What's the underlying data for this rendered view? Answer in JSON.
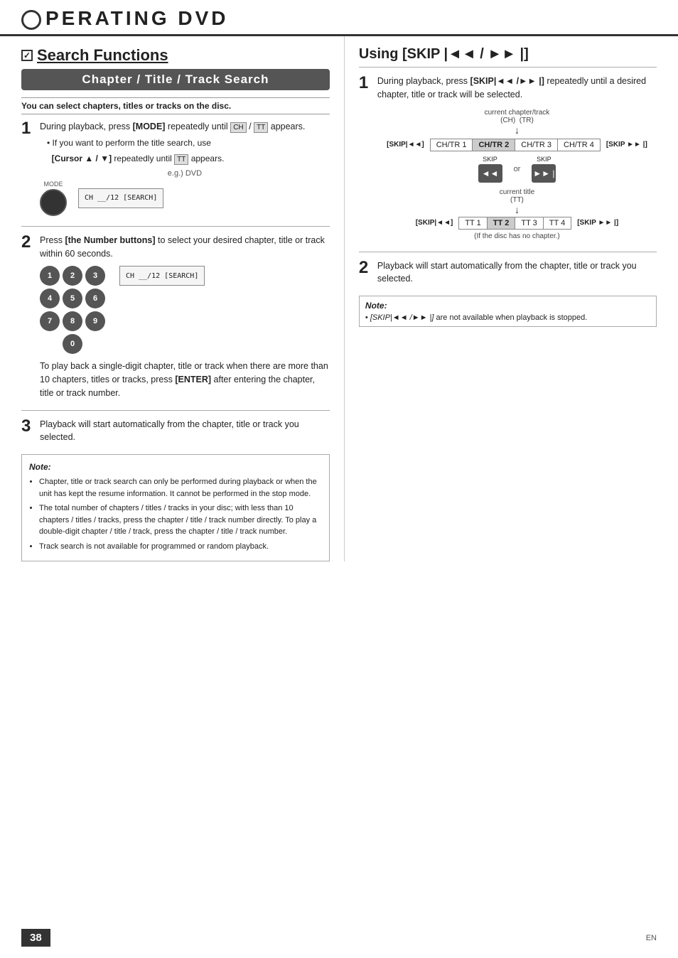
{
  "header": {
    "title": "PERATING   DVD",
    "circle": true
  },
  "left": {
    "section_checkbox": true,
    "section_title": "Search Functions",
    "banner": "Chapter / Title / Track Search",
    "intro": "You can select chapters, titles or tracks on the disc.",
    "step1": {
      "number": "1",
      "main": "During playback, press [MODE] repeatedly until",
      "display_text": "“CH” / “TT” appears.",
      "sub1": "• If you want to perform the title search, use",
      "sub2": "  [Cursor ▲ / ▼] repeatedly until “TT” appears.",
      "eg_label": "e.g.) DVD",
      "mode_label": "MODE",
      "search_display": "CH  __/12 [SEARCH]"
    },
    "step2": {
      "number": "2",
      "main": "Press [the Number buttons] to select your desired chapter, title or track within 60 seconds.",
      "search_display": "CH  __/12 [SEARCH]",
      "numbers": [
        "1",
        "2",
        "3",
        "4",
        "5",
        "6",
        "7",
        "8",
        "9",
        "0"
      ],
      "extra_text": "To play back a single-digit chapter, title or track when there are more than 10 chapters, titles or tracks, press [ENTER] after entering the chapter, title or track number."
    },
    "step3": {
      "number": "3",
      "main": "Playback will start automatically from the chapter, title or track you selected."
    },
    "note": {
      "title": "Note:",
      "bullets": [
        "Chapter, title or track search can only be performed during playback or when the unit has kept the resume information. It cannot be performed in the stop mode.",
        "The total number of chapters / titles / tracks in your disc; with less than 10 chapters / titles / tracks, press the chapter / title / track number directly. To play a double-digit chapter / title / track, press the chapter / title / track number.",
        "Track search is not available for programmed or random playback."
      ]
    }
  },
  "right": {
    "using_title": "Using [SKIP |◄◄ / ►► |]",
    "step1": {
      "number": "1",
      "main": "During playback, press [SKIP|◄◄ /►► |] repeatedly until a desired chapter, title or track will be selected.",
      "current_chapter_track": "current chapter/track",
      "ch_tr": "(CH)    (TR)",
      "boxes_top": [
        "CH/TR 1",
        "CH/TR 2",
        "CH/TR 3",
        "CH/TR 4"
      ],
      "highlight_top": 1,
      "skip_back_label": "[SKIP|◄◄]",
      "skip_fwd_label": "[SKIP ►► |]",
      "skip_back_phys": "◄◄",
      "or_text": "or",
      "skip_fwd_phys": "►► |",
      "current_title": "current title",
      "tt_label": "(TT)",
      "boxes_bottom": [
        "TT 1",
        "TT 2",
        "TT 3",
        "TT 4"
      ],
      "highlight_bottom": 1,
      "skip_back_label2": "[SKIP|◄◄]",
      "skip_fwd_label2": "[SKIP ►► |]",
      "no_chapter_note": "(If the disc has no chapter.)"
    },
    "step2": {
      "number": "2",
      "main": "Playback will start automatically from the chapter, title or track you selected."
    },
    "note": {
      "title": "Note:",
      "bullet": "• [SKIP|◄◄ /►► |] are not available when playback is stopped."
    }
  },
  "footer": {
    "page_number": "38",
    "lang": "EN"
  }
}
